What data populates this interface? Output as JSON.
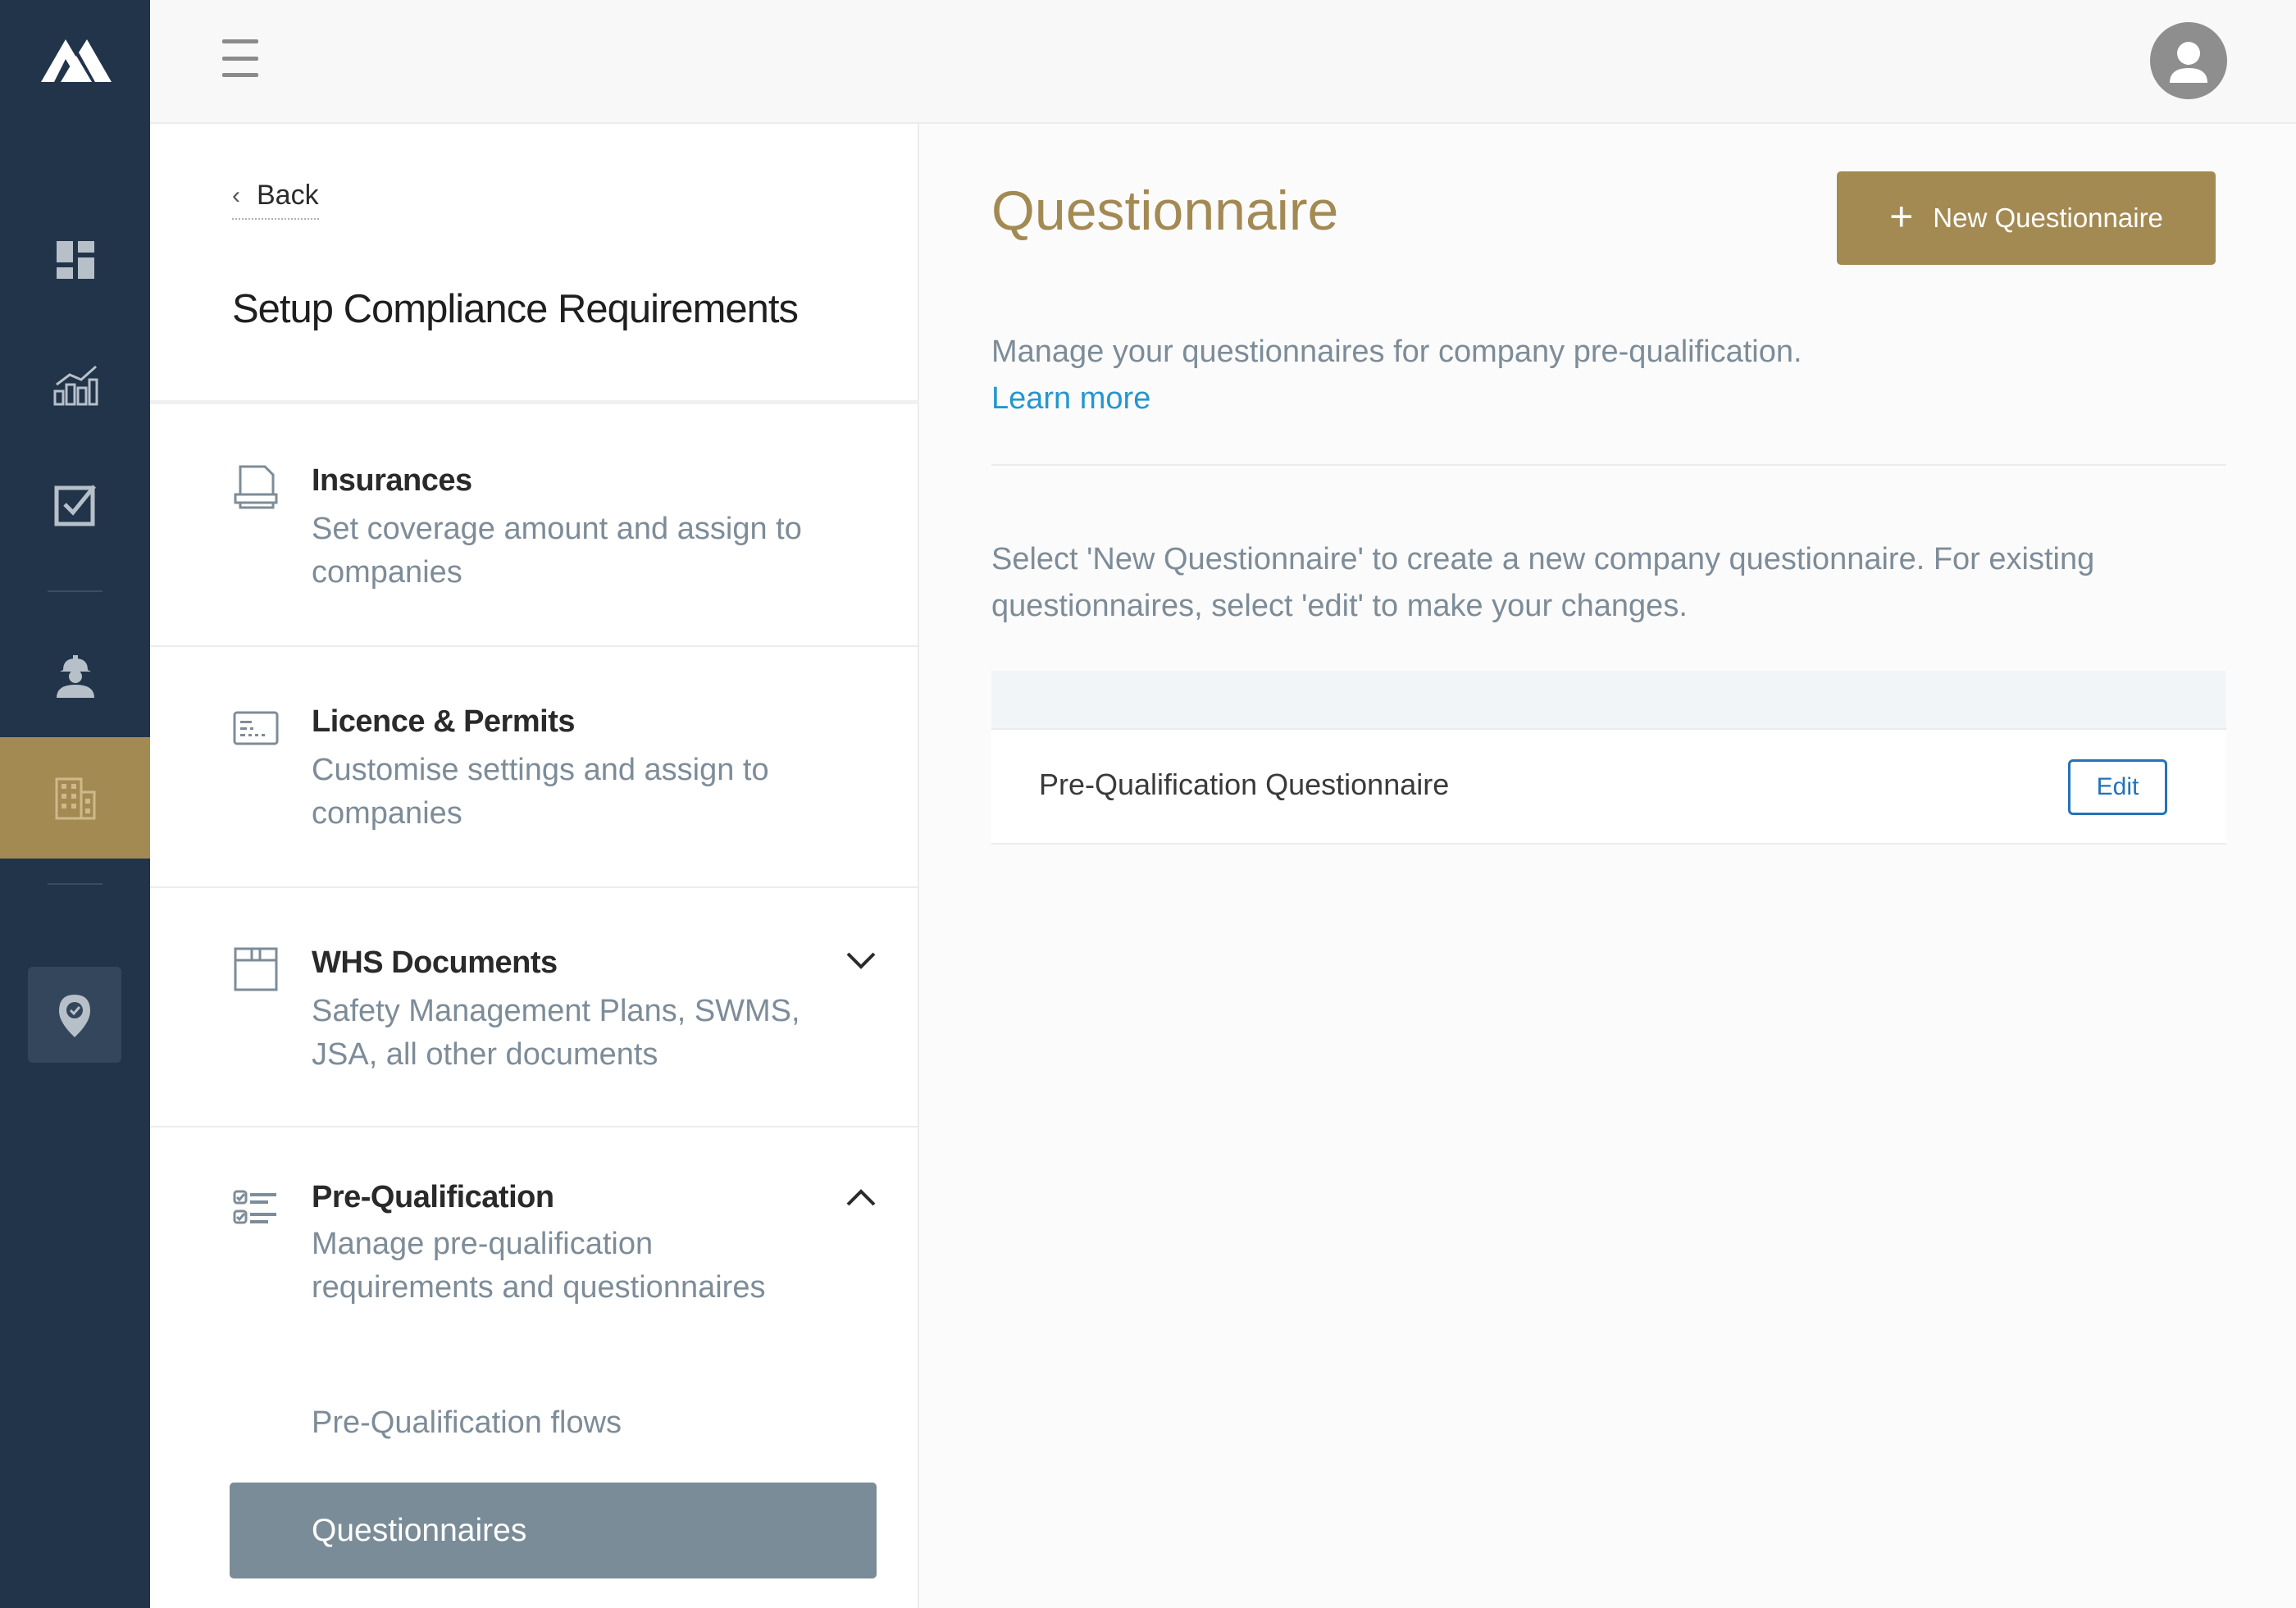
{
  "rail": {
    "logo": "mountain-logo",
    "items": [
      "dashboard-icon",
      "analytics-icon",
      "tasks-icon",
      "workers-icon",
      "companies-icon",
      "location-icon"
    ],
    "active_item": "companies-icon",
    "active_color": "#a38a53"
  },
  "topbar": {
    "menu_icon": "hamburger-icon",
    "user_icon": "user-avatar-icon"
  },
  "panel": {
    "back_label": "Back",
    "title": "Setup Compliance Requirements",
    "sections": [
      {
        "title": "Insurances",
        "description": "Set coverage amount and assign to companies",
        "icon": "document-icon"
      },
      {
        "title": "Licence & Permits",
        "description": "Customise settings and assign to companies",
        "icon": "id-card-icon"
      },
      {
        "title": "WHS Documents",
        "description": "Safety Management Plans, SWMS, JSA, all other documents",
        "icon": "box-icon",
        "expanded": false
      },
      {
        "title": "Pre-Qualification",
        "description": "Manage pre-qualification requirements and questionnaires",
        "icon": "checklist-icon",
        "expanded": true,
        "children": [
          {
            "label": "Pre-Qualification flows",
            "active": false
          },
          {
            "label": "Questionnaires",
            "active": true
          }
        ]
      }
    ]
  },
  "main": {
    "title": "Questionnaire",
    "new_button_label": "New Questionnaire",
    "intro": "Manage your questionnaires for company pre-qualification.",
    "learn_more": "Learn more",
    "hint": "Select 'New Questionnaire' to create a new company questionnaire. For existing questionnaires, select 'edit' to make your changes.",
    "table": {
      "rows": [
        {
          "name": "Pre-Qualification Questionnaire",
          "action": "Edit"
        }
      ]
    }
  },
  "colors": {
    "accent": "#a38a53",
    "rail": "#21344a",
    "link": "#2496d0",
    "edit": "#2473b8"
  }
}
